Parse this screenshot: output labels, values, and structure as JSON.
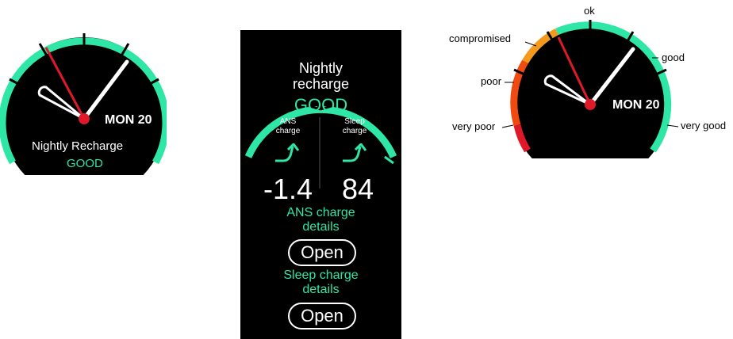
{
  "colors": {
    "accent": "#2ee6a6",
    "needle_red": "#e0192a",
    "background": "#000000",
    "zone_very_poor": "#e0192a",
    "zone_poor": "#f04a10",
    "zone_compromised": "#f39a1c"
  },
  "watch_left": {
    "date": "MON 20",
    "title": "Nightly Recharge",
    "status": "GOOD"
  },
  "watch_middle": {
    "title_line1": "Nightly",
    "title_line2": "recharge",
    "status": "GOOD",
    "ans": {
      "label_line1": "ANS",
      "label_line2": "charge",
      "value": "-1.4",
      "trend_icon": "trend-up-icon"
    },
    "sleep": {
      "label_line1": "Sleep",
      "label_line2": "charge",
      "value": "84",
      "trend_icon": "trend-up-icon"
    },
    "ans_details_line1": "ANS charge",
    "ans_details_line2": "details",
    "open_label_1": "Open",
    "sleep_details_line1": "Sleep charge",
    "sleep_details_line2": "details",
    "open_label_2": "Open"
  },
  "watch_right": {
    "date": "MON 20",
    "scale_labels": {
      "ok": "ok",
      "compromised": "compromised",
      "poor": "poor",
      "very_poor": "very poor",
      "good": "good",
      "very_good": "very good"
    }
  }
}
